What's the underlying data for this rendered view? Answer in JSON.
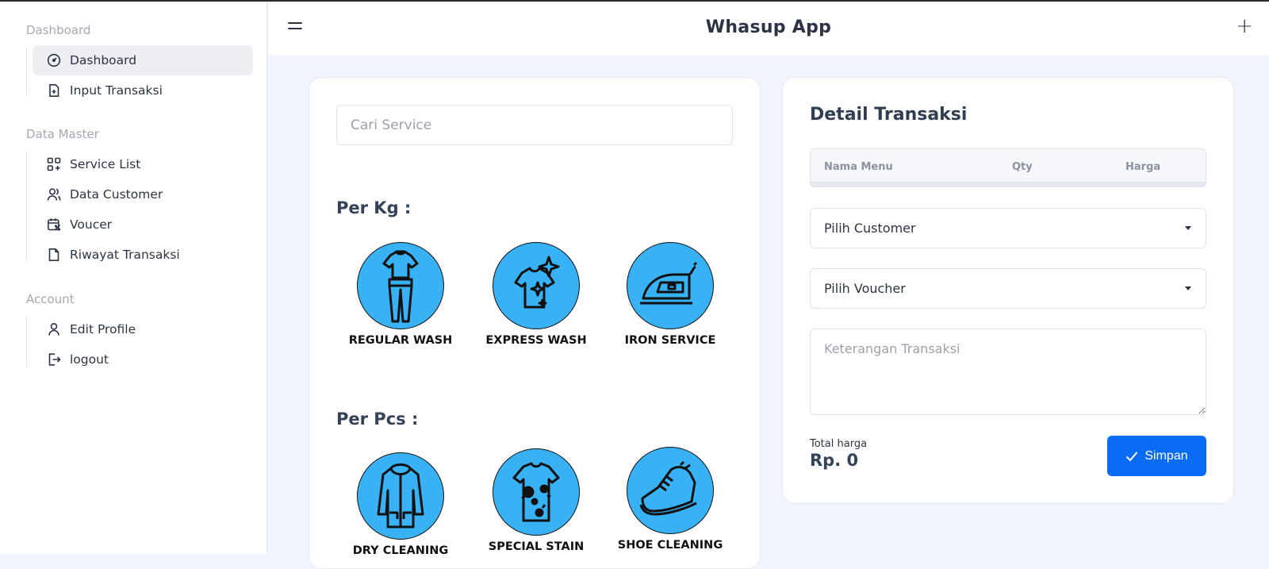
{
  "header": {
    "title": "Whasup App"
  },
  "sidebar": {
    "sections": [
      {
        "title": "Dashboard",
        "items": [
          {
            "label": "Dashboard",
            "icon": "gauge-icon",
            "active": true
          },
          {
            "label": "Input Transaksi",
            "icon": "file-plus-icon"
          }
        ]
      },
      {
        "title": "Data Master",
        "items": [
          {
            "label": "Service List",
            "icon": "grid-plus-icon"
          },
          {
            "label": "Data Customer",
            "icon": "users-icon"
          },
          {
            "label": "Voucer",
            "icon": "calendar-discount-icon"
          },
          {
            "label": "Riwayat Transaksi",
            "icon": "file-icon"
          }
        ]
      },
      {
        "title": "Account",
        "items": [
          {
            "label": "Edit Profile",
            "icon": "user-icon"
          },
          {
            "label": "logout",
            "icon": "logout-icon"
          }
        ]
      }
    ]
  },
  "services": {
    "search_placeholder": "Cari Service",
    "groups": [
      {
        "title": "Per Kg :",
        "items": [
          {
            "label": "REGULAR WASH",
            "icon": "clothes-icon"
          },
          {
            "label": "EXPRESS WASH",
            "icon": "sparkle-shirt-icon"
          },
          {
            "label": "IRON SERVICE",
            "icon": "iron-icon"
          }
        ]
      },
      {
        "title": "Per Pcs :",
        "items": [
          {
            "label": "DRY CLEANING",
            "icon": "jacket-icon"
          },
          {
            "label": "SPECIAL STAIN",
            "icon": "stained-shirt-icon"
          },
          {
            "label": "SHOE CLEANING",
            "icon": "shoe-icon"
          }
        ]
      }
    ]
  },
  "detail": {
    "title": "Detail Transaksi",
    "columns": [
      "Nama Menu",
      "Qty",
      "Harga"
    ],
    "customer_select": "Pilih Customer",
    "voucher_select": "Pilih Voucher",
    "notes_placeholder": "Keterangan Transaksi",
    "total_label": "Total harga",
    "total_value": "Rp. 0",
    "save_label": "Simpan"
  },
  "colors": {
    "accent": "#0a6cf5",
    "service_circle": "#38b2f5"
  }
}
